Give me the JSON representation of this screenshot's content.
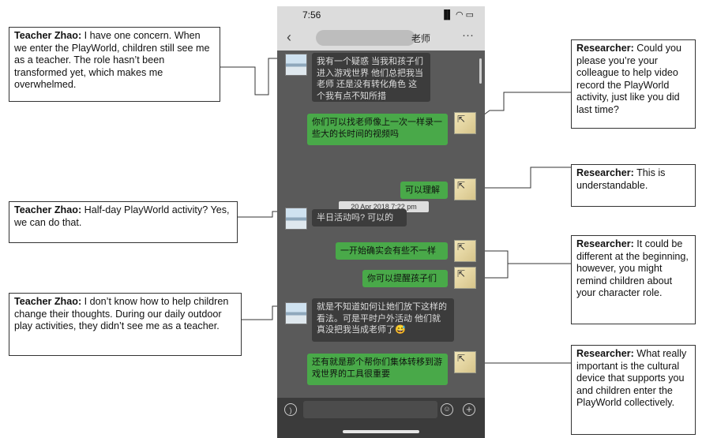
{
  "phone": {
    "status_time": "7:56",
    "status_icons": "▐▌ ◠ ▭",
    "back_icon": "‹",
    "header_title_suffix": "老师",
    "more_icon": "···",
    "timestamp": "20 Apr 2018 7:22 pm"
  },
  "messages": [
    {
      "side": "left",
      "text": "我有一个疑惑 当我和孩子们进入游戏世界 他们总把我当老师 还是没有转化角色 这个我有点不知所措"
    },
    {
      "side": "right",
      "text": "你们可以找老师像上一次一样录一些大的长时间的视频吗"
    },
    {
      "side": "right",
      "text": "可以理解"
    },
    {
      "side": "left",
      "text": "半日活动吗? 可以的"
    },
    {
      "side": "right",
      "text": "一开始确实会有些不一样"
    },
    {
      "side": "right",
      "text": "你可以提醒孩子们"
    },
    {
      "side": "left",
      "text": "就是不知道如何让她们放下这样的看法。可是平时户外活动 他们就真没把我当成老师了😅"
    },
    {
      "side": "right",
      "text": "还有就是那个帮你们集体转移到游戏世界的工具很重要"
    }
  ],
  "annotations": [
    {
      "speaker": "Teacher Zhao:",
      "text": " I have one concern. When we enter the PlayWorld, children still see me as a teacher. The role hasn’t been transformed yet, which makes me overwhelmed."
    },
    {
      "speaker": "Teacher Zhao:",
      "text": " Half-day PlayWorld activity? Yes, we can do  that."
    },
    {
      "speaker": "Teacher Zhao:",
      "text": " I don’t know how to help children change their thoughts. During our daily outdoor  play activities, they didn’t see me as a teacher."
    },
    {
      "speaker": "Researcher:",
      "text": " Could you please you’re your colleague to help video record the PlayWorld activity, just like you did last time?"
    },
    {
      "speaker": "Researcher:",
      "text": " This is understandable."
    },
    {
      "speaker": "Researcher:",
      "text": " It could be different at the beginning, however, you might remind children about your character role."
    },
    {
      "speaker": "Researcher:",
      "text": " What really important is the cultural device that supports you and children enter the PlayWorld collectively."
    }
  ],
  "colors": {
    "bubble_right": "#49a949",
    "bubble_left": "#3c3c3c",
    "chat_bg": "#5a5a5a",
    "header_bg": "#dcdcdc"
  },
  "icons": [
    "back-icon",
    "more-icon",
    "signal-icon",
    "wifi-icon",
    "battery-icon",
    "voice-icon",
    "emoji-icon",
    "plus-icon",
    "avatar-icon"
  ]
}
